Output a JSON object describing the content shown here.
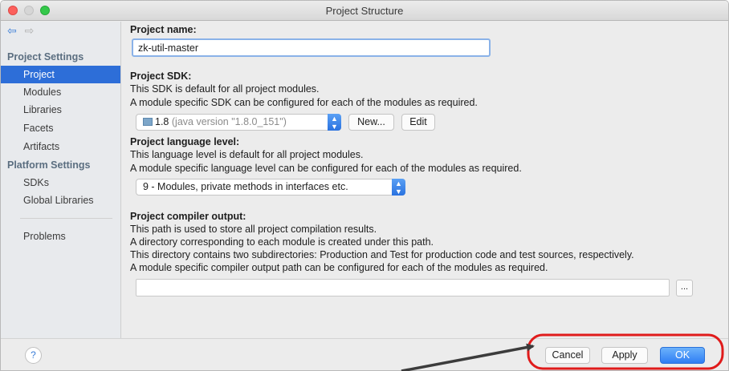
{
  "window": {
    "title": "Project Structure"
  },
  "sidebar": {
    "sections": [
      {
        "header": "Project Settings",
        "items": [
          "Project",
          "Modules",
          "Libraries",
          "Facets",
          "Artifacts"
        ]
      },
      {
        "header": "Platform Settings",
        "items": [
          "SDKs",
          "Global Libraries"
        ]
      }
    ],
    "extra_item": "Problems",
    "selected": "Project"
  },
  "project": {
    "name_label": "Project name:",
    "name_value": "zk-util-master",
    "sdk_label": "Project SDK:",
    "sdk_desc_1": "This SDK is default for all project modules.",
    "sdk_desc_2": "A module specific SDK can be configured for each of the modules as required.",
    "sdk_version": "1.8",
    "sdk_detail": "(java version \"1.8.0_151\")",
    "sdk_new_button": "New...",
    "sdk_edit_button": "Edit",
    "lang_label": "Project language level:",
    "lang_desc_1": "This language level is default for all project modules.",
    "lang_desc_2": "A module specific language level can be configured for each of the modules as required.",
    "lang_value": "9 - Modules, private methods in interfaces etc.",
    "output_label": "Project compiler output:",
    "output_desc_1": "This path is used to store all project compilation results.",
    "output_desc_2": "A directory corresponding to each module is created under this path.",
    "output_desc_3": "This directory contains two subdirectories: Production and Test for production code and test sources, respectively.",
    "output_desc_4": "A module specific compiler output path can be configured for each of the modules as required.",
    "output_value": "",
    "browse_label": "..."
  },
  "footer": {
    "help_label": "?",
    "cancel_label": "Cancel",
    "apply_label": "Apply",
    "ok_label": "OK"
  },
  "colors": {
    "selection": "#2d6ed8",
    "annotation_ring": "#e01b1b",
    "ok_button": "#2f7ef4"
  }
}
